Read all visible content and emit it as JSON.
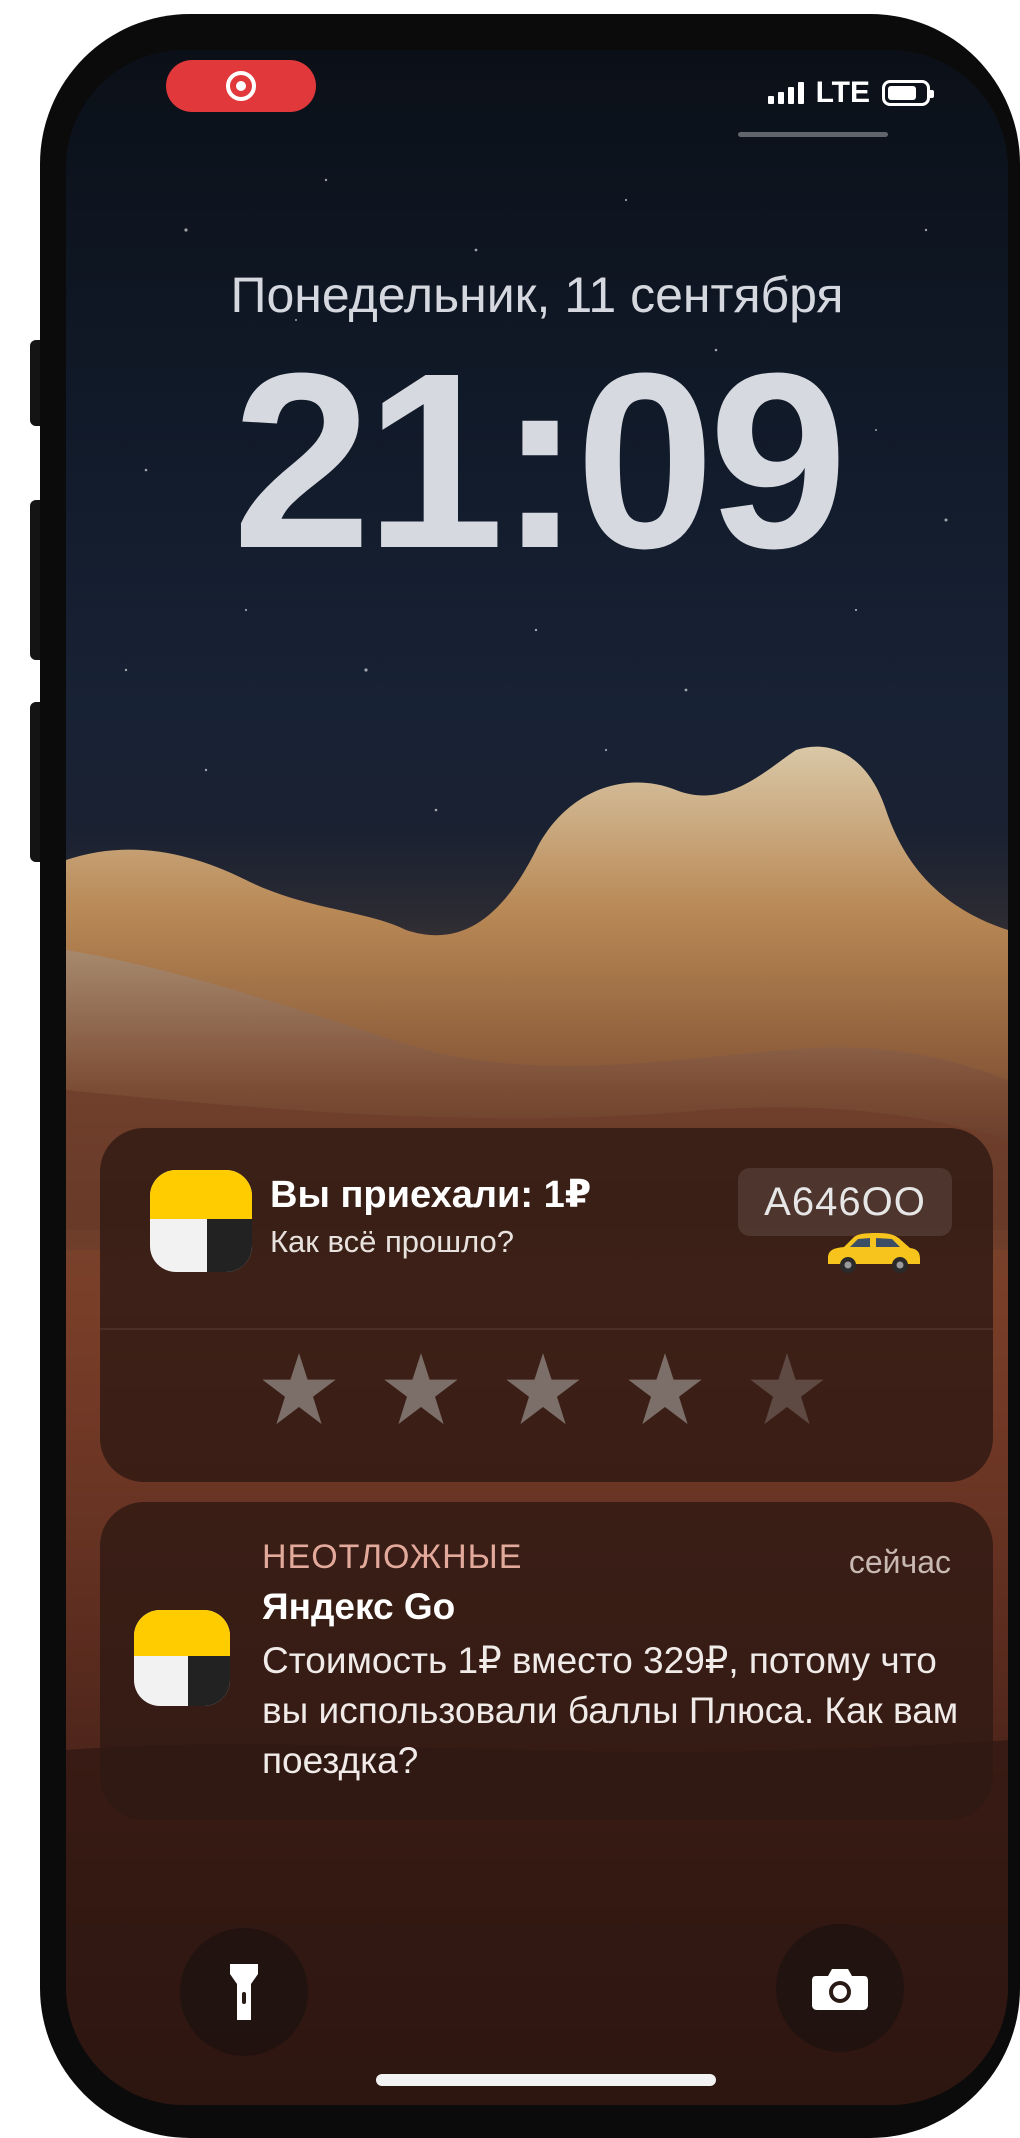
{
  "status_bar": {
    "recording_indicator": "record-icon",
    "signal_icon": "signal-bars-icon",
    "network": "LTE",
    "battery_icon": "battery-icon"
  },
  "lock_screen": {
    "date": "Понедельник, 11 сентября",
    "time": "21:09"
  },
  "notifications": [
    {
      "app_icon": "yandex-go-icon",
      "title": "Вы приехали: 1₽",
      "subtitle": "Как всё прошло?",
      "plate": "А646ОО",
      "car_icon": "yellow-taxi-icon",
      "rating": {
        "max": 5,
        "filled": 0
      }
    },
    {
      "app_icon": "yandex-go-icon",
      "tag": "НЕОТЛОЖНЫЕ",
      "time": "сейчас",
      "app_name": "Яндекс Go",
      "body": "Стоимость 1₽ вместо 329₽, потому что вы использовали баллы Плюса. Как вам поездка?"
    }
  ],
  "quick_actions": {
    "left_icon": "flashlight-icon",
    "right_icon": "camera-icon"
  },
  "colors": {
    "record_red": "#e0383b",
    "yandex_yellow": "#ffcc00",
    "tag_color": "#e3a99a"
  }
}
